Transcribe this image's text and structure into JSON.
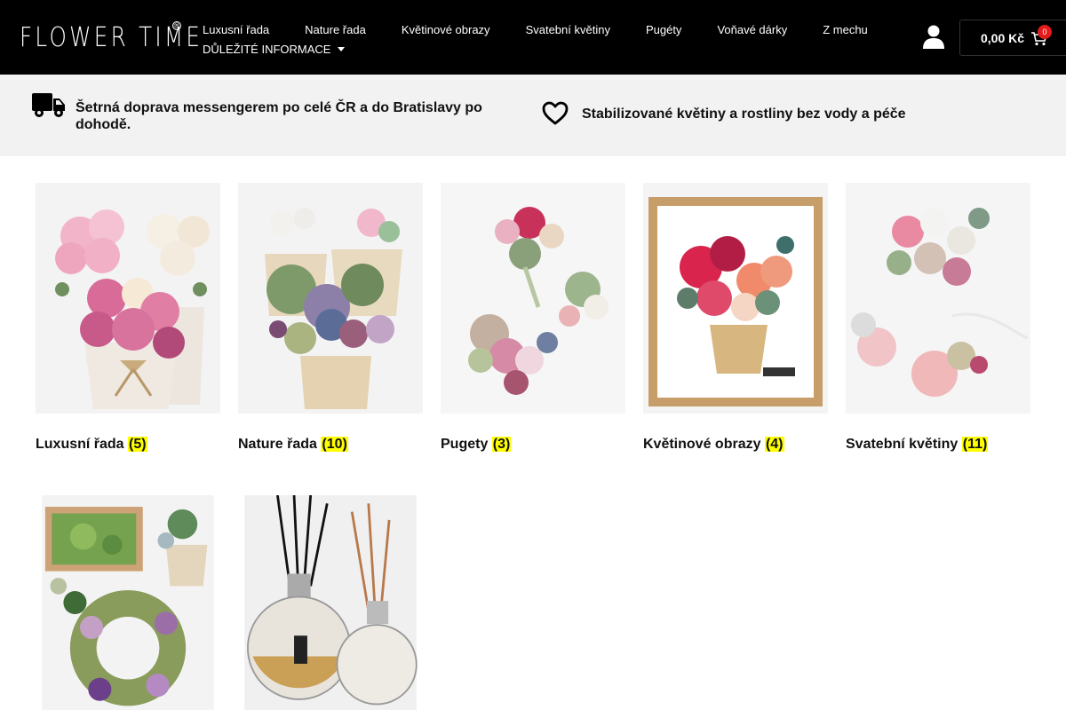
{
  "header": {
    "logo_text": "FLOWER TIME",
    "logo_mark": "®",
    "nav": [
      {
        "label": "Luxusní řada"
      },
      {
        "label": "Nature řada"
      },
      {
        "label": "Květinové obrazy"
      },
      {
        "label": "Svatební květiny"
      },
      {
        "label": "Pugéty"
      },
      {
        "label": "Voňavé dárky"
      },
      {
        "label": "Z mechu"
      }
    ],
    "nav_dropdown": "DŮLEŽITÉ INFORMACE",
    "cart_price": "0,00 Kč",
    "cart_count": "0",
    "user_icon": "user-icon",
    "cart_icon": "cart-icon"
  },
  "info": {
    "delivery": "Šetrná doprava messengerem po celé ČR a do Bratislavy po dohodě.",
    "stabilized": "Stabilizované květiny a rostliny bez vody a péče",
    "delivery_icon": "truck-icon",
    "stabilized_icon": "heart-icon"
  },
  "categories": [
    {
      "name": "Luxusní řada",
      "count": "(5)"
    },
    {
      "name": "Nature řada",
      "count": "(10)"
    },
    {
      "name": "Pugety",
      "count": "(3)"
    },
    {
      "name": "Květinové obrazy",
      "count": "(4)"
    },
    {
      "name": "Svatební květiny",
      "count": "(11)"
    },
    {
      "name": "",
      "count": ""
    },
    {
      "name": "",
      "count": ""
    }
  ],
  "colors": {
    "header_bg": "#000000",
    "info_bg": "#f2f2f2",
    "count_highlight": "#ffff00",
    "cart_badge": "#e31b1b"
  }
}
